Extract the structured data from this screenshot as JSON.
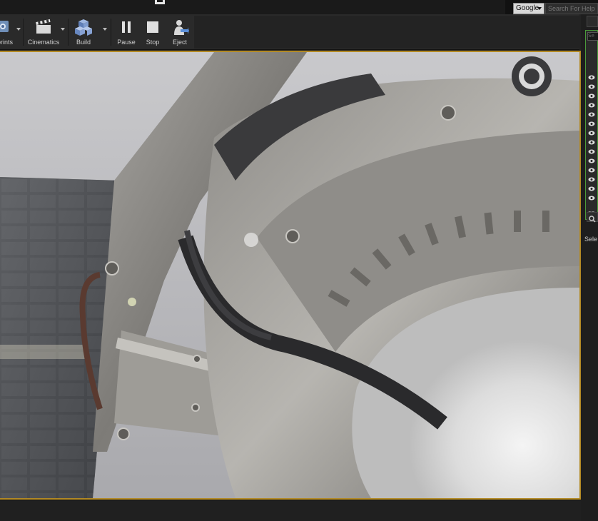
{
  "header": {
    "search_engine": "Google",
    "search_placeholder": "Search For Help"
  },
  "toolbar": {
    "blueprints_label": "prints",
    "cinematics_label": "Cinematics",
    "build_label": "Build",
    "pause_label": "Pause",
    "stop_label": "Stop",
    "eject_label": "Eject"
  },
  "outliner": {
    "search_placeholder": "Se",
    "count": "27"
  },
  "details": {
    "hint": "Sele"
  },
  "colors": {
    "viewport_border": "#b38a24",
    "outliner_border": "#4a9a3a"
  }
}
